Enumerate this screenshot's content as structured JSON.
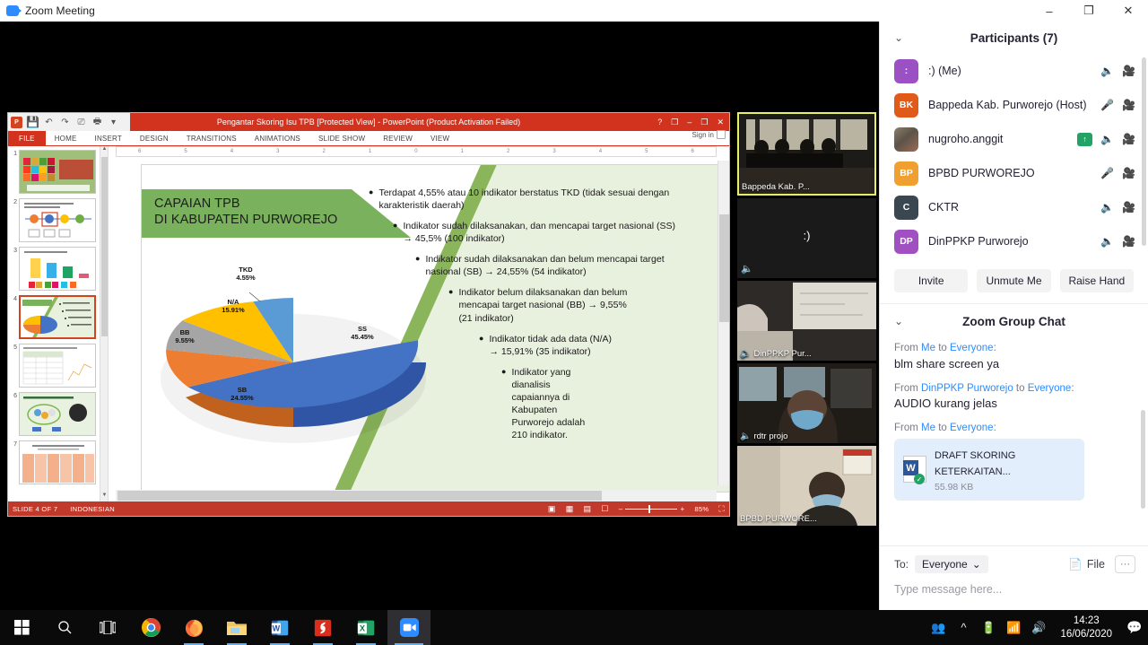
{
  "window": {
    "title": "Zoom Meeting",
    "minimize": "–",
    "restore": "❐",
    "close": "✕"
  },
  "powerpoint": {
    "title": "Pengantar Skoring Isu TPB [Protected View]  -  PowerPoint (Product Activation Failed)",
    "help": "?",
    "ribbon_display": "❐",
    "minimize": "–",
    "restore": "❐",
    "close": "✕",
    "signin": "Sign in",
    "tabs": [
      "FILE",
      "HOME",
      "INSERT",
      "DESIGN",
      "TRANSITIONS",
      "ANIMATIONS",
      "SLIDE SHOW",
      "REVIEW",
      "VIEW"
    ],
    "quick_access": [
      "powerpoint-logo",
      "save-icon",
      "undo-icon",
      "redo-icon",
      "start-presentation-icon",
      "print-preview-icon",
      "customize-qat-icon"
    ],
    "ruler_ticks": [
      "6",
      "5",
      "4",
      "3",
      "2",
      "1",
      "0",
      "1",
      "2",
      "3",
      "4",
      "5",
      "6"
    ],
    "thumbnails": [
      "1",
      "2",
      "3",
      "4",
      "5",
      "6",
      "7"
    ],
    "selected_thumbnail": 4,
    "status": {
      "slide": "SLIDE 4 OF 7",
      "language": "INDONESIAN",
      "zoom": "85%",
      "view_icons": [
        "normal-view-icon",
        "slide-sorter-icon",
        "reading-view-icon",
        "slide-show-icon"
      ],
      "zoom_out": "–",
      "zoom_in": "+",
      "fit_icon": "fit-slide-icon"
    },
    "slide": {
      "title_line1": "CAPAIAN TPB",
      "title_line2": "DI KABUPATEN PURWOREJO",
      "bullets": [
        {
          "indent": 0,
          "text": "Terdapat 4,55% atau 10 indikator berstatus TKD (tidak sesuai dengan karakteristik daerah)"
        },
        {
          "indent": 1,
          "text": "Indikator sudah dilaksanakan, dan mencapai target nasional (SS) → 45,5% (100 indikator)"
        },
        {
          "indent": 2,
          "text": "Indikator sudah dilaksanakan dan belum mencapai target nasional (SB) → 24,55% (54 indikator)"
        },
        {
          "indent": 3,
          "text": "Indikator belum dilaksanakan dan belum mencapai target nasional (BB) → 9,55% (21 indikator)"
        },
        {
          "indent": 4,
          "text": "Indikator tidak ada data (N/A) → 15,91% (35 indikator)"
        },
        {
          "indent": 5,
          "text": "Indikator yang dianalisis capaiannya di Kabupaten Purworejo adalah 210 indikator."
        }
      ]
    }
  },
  "chart_data": {
    "type": "pie",
    "title": "CAPAIAN TPB DI KABUPATEN PURWOREJO",
    "categories": [
      "SS",
      "SB",
      "BB",
      "N/A",
      "TKD"
    ],
    "values": [
      45.45,
      24.55,
      9.55,
      15.91,
      4.55
    ],
    "value_labels": [
      "45.45%",
      "24.55%",
      "9.55%",
      "15.91%",
      "4.55%"
    ],
    "counts": [
      100,
      54,
      21,
      35,
      10
    ],
    "unit": "%",
    "total_indicators": 210,
    "colors": [
      "#4472c4",
      "#ed7d31",
      "#a5a5a5",
      "#ffc000",
      "#5b9bd5"
    ],
    "legend": "on-slice-labels",
    "three_d": true
  },
  "video_tiles": [
    {
      "name": "Bappeda Kab. P...",
      "active": true,
      "muted": false,
      "avatar": false
    },
    {
      "name": "",
      "active": false,
      "muted": true,
      "avatar": true,
      "avatar_text": ":)"
    },
    {
      "name": "DinPPKP Pur...",
      "active": false,
      "muted": true,
      "avatar": false
    },
    {
      "name": "rdtr projo",
      "active": false,
      "muted": true,
      "avatar": false
    },
    {
      "name": "BPBD PURWORE...",
      "active": false,
      "muted": false,
      "avatar": false
    }
  ],
  "participants": {
    "header": "Participants (7)",
    "collapse_icon": "chevron-down-icon",
    "items": [
      {
        "initials": ":",
        "name": ":) (Me)",
        "color": "#9b51c4",
        "photo": false,
        "mic": "muted",
        "video": "off",
        "badge": null
      },
      {
        "initials": "BK",
        "name": "Bappeda Kab. Purworejo (Host)",
        "color": "#e05a19",
        "photo": false,
        "mic": "on",
        "video": "on",
        "badge": null
      },
      {
        "initials": "",
        "name": "nugroho.anggit",
        "color": "#8d7f6d",
        "photo": true,
        "mic": "muted",
        "video": "on",
        "badge": "↑"
      },
      {
        "initials": "BP",
        "name": "BPBD PURWOREJO",
        "color": "#f0a030",
        "photo": false,
        "mic": "on",
        "video": "on",
        "badge": null
      },
      {
        "initials": "C",
        "name": "CKTR",
        "color": "#3a4750",
        "photo": false,
        "mic": "muted",
        "video": "off",
        "badge": null
      },
      {
        "initials": "DP",
        "name": "DinPPKP Purworejo",
        "color": "#a050c0",
        "photo": false,
        "mic": "muted",
        "video": "on",
        "badge": null
      }
    ],
    "buttons": [
      "Invite",
      "Unmute Me",
      "Raise Hand"
    ]
  },
  "chat": {
    "header": "Zoom Group Chat",
    "collapse_icon": "chevron-down-icon",
    "messages": [
      {
        "prefix": "From ",
        "sender": "Me",
        "mid": " to ",
        "target": "Everyone",
        "suffix": ":",
        "text": "blm share screen ya",
        "file": null
      },
      {
        "prefix": "From ",
        "sender": "DinPPKP Purworejo",
        "mid": " to ",
        "target": "Everyone",
        "suffix": ":",
        "text": "AUDIO kurang jelas",
        "file": null
      },
      {
        "prefix": "From ",
        "sender": "Me",
        "mid": " to ",
        "target": "Everyone",
        "suffix": ":",
        "text": null,
        "file": {
          "name": "DRAFT SKORING KETERKAITAN...",
          "size": "55.98 KB",
          "icon": "word-document-icon",
          "status": "downloaded"
        }
      }
    ],
    "to_label": "To:",
    "to_value": "Everyone",
    "file_button": "File",
    "more_button": "···",
    "input_placeholder": "Type message here..."
  },
  "taskbar": {
    "items": [
      {
        "name": "start-button",
        "icon": "windows-logo"
      },
      {
        "name": "search-button",
        "icon": "search-icon"
      },
      {
        "name": "task-view-button",
        "icon": "task-view-icon"
      },
      {
        "name": "chrome-button",
        "icon": "chrome-icon"
      },
      {
        "name": "firefox-button",
        "icon": "firefox-icon"
      },
      {
        "name": "file-explorer-button",
        "icon": "folder-icon"
      },
      {
        "name": "word-button",
        "icon": "word-icon"
      },
      {
        "name": "pdf-reader-button",
        "icon": "pdf-icon"
      },
      {
        "name": "excel-button",
        "icon": "excel-icon"
      },
      {
        "name": "zoom-button",
        "icon": "zoom-icon"
      }
    ],
    "tray": [
      "people-icon",
      "show-hidden-icons-icon",
      "battery-icon",
      "wifi-icon",
      "volume-icon"
    ],
    "time": "14:23",
    "date": "16/06/2020",
    "notification_icon": "notification-center-icon"
  }
}
